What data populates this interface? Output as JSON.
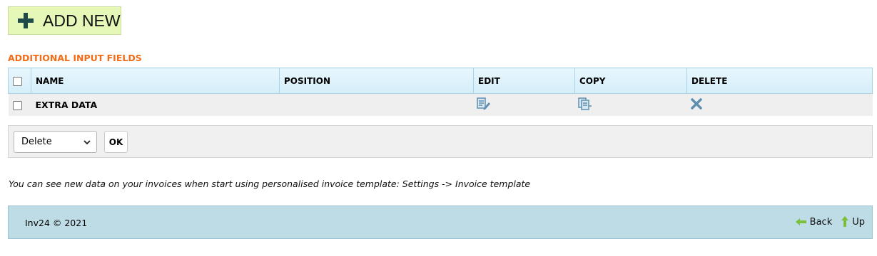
{
  "header": {
    "add_new_label": "ADD NEW"
  },
  "section": {
    "title": "ADDITIONAL INPUT FIELDS"
  },
  "table": {
    "columns": {
      "name": "NAME",
      "position": "POSITION",
      "edit": "EDIT",
      "copy": "COPY",
      "delete": "DELETE"
    },
    "rows": [
      {
        "name": "EXTRA DATA",
        "position": ""
      }
    ]
  },
  "bulk_actions": {
    "selected": "Delete",
    "ok_label": "OK"
  },
  "note": "You can see new data on your invoices when start using personalised invoice template: Settings -> Invoice template",
  "footer": {
    "copyright": "Inv24 © 2021",
    "back_label": "Back",
    "up_label": "Up"
  },
  "icons": {
    "add": "plus-icon",
    "edit": "edit-document-icon",
    "copy": "copy-document-icon",
    "delete": "close-x-icon",
    "back": "arrow-left-icon",
    "up": "arrow-up-icon"
  },
  "colors": {
    "accent_orange": "#f26b17",
    "add_button_bg": "#e6f8b8",
    "header_bg": "#d4eef9",
    "footer_bg": "#bddce6",
    "icon_blue": "#5f8fb0",
    "arrow_green": "#7bbf3a"
  }
}
